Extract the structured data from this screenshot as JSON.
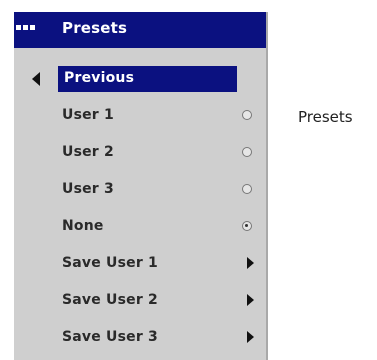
{
  "menu": {
    "title": "Presets",
    "title_icon": "menu-dots-icon",
    "items": [
      {
        "label": "Previous",
        "control": "back-arrow",
        "selected": true
      },
      {
        "label": "User 1",
        "control": "radio",
        "checked": false
      },
      {
        "label": "User 2",
        "control": "radio",
        "checked": false
      },
      {
        "label": "User 3",
        "control": "radio",
        "checked": false
      },
      {
        "label": "None",
        "control": "radio",
        "checked": true
      },
      {
        "label": "Save User 1",
        "control": "submenu-arrow"
      },
      {
        "label": "Save User 2",
        "control": "submenu-arrow"
      },
      {
        "label": "Save User 3",
        "control": "submenu-arrow"
      }
    ]
  },
  "caption": "Presets",
  "colors": {
    "title_bg": "#0b1180",
    "panel_bg": "#cfcfcf",
    "selection_bg": "#0b1180",
    "text": "#2a2a2a"
  }
}
